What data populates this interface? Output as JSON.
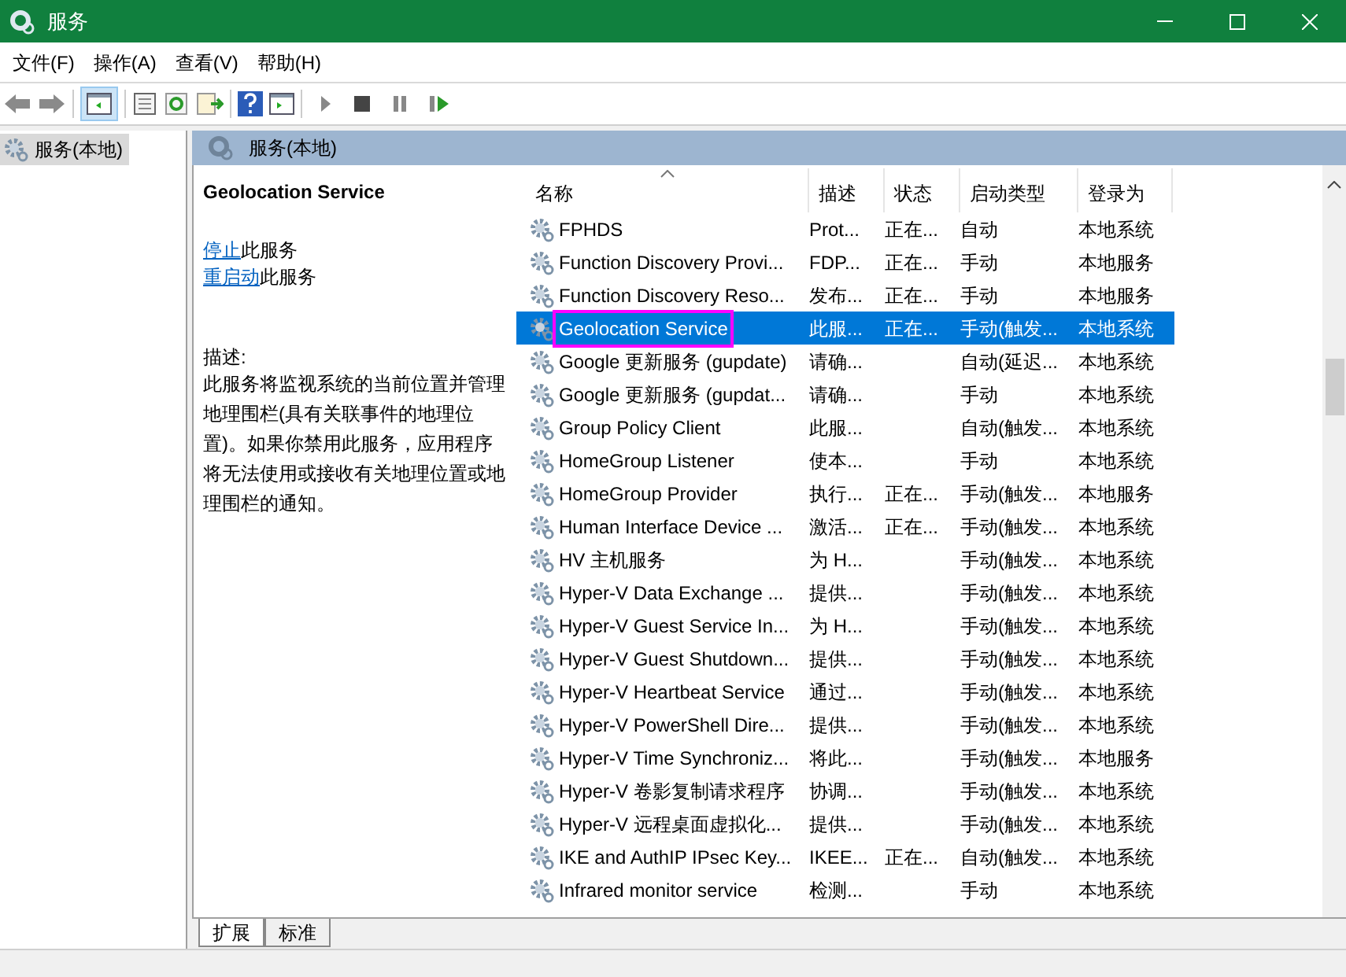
{
  "window": {
    "title": "服务"
  },
  "menu": [
    "文件(F)",
    "操作(A)",
    "查看(V)",
    "帮助(H)"
  ],
  "tree": {
    "items": [
      {
        "label": "服务(本地)",
        "selected": true
      }
    ]
  },
  "panel_header": "服务(本地)",
  "details": {
    "title": "Geolocation Service",
    "actions": [
      {
        "link": "停止",
        "rest": "此服务"
      },
      {
        "link": "重启动",
        "rest": "此服务"
      }
    ],
    "description_label": "描述:",
    "description": "此服务将监视系统的当前位置并管理地理围栏(具有关联事件的地理位置)。如果你禁用此服务，应用程序将无法使用或接收有关地理位置或地理围栏的通知。"
  },
  "table": {
    "columns": [
      {
        "label": "名称",
        "sorted": true
      },
      {
        "label": "描述",
        "sorted": false
      },
      {
        "label": "状态",
        "sorted": false
      },
      {
        "label": "启动类型",
        "sorted": false
      },
      {
        "label": "登录为",
        "sorted": false
      }
    ],
    "rows": [
      {
        "cells": [
          "FPHDS",
          "Prot...",
          "正在...",
          "自动",
          "本地系统"
        ],
        "selected": false,
        "annotated": false
      },
      {
        "cells": [
          "Function Discovery Provi...",
          "FDP...",
          "正在...",
          "手动",
          "本地服务"
        ],
        "selected": false,
        "annotated": false
      },
      {
        "cells": [
          "Function Discovery Reso...",
          "发布...",
          "正在...",
          "手动",
          "本地服务"
        ],
        "selected": false,
        "annotated": false
      },
      {
        "cells": [
          "Geolocation Service",
          "此服...",
          "正在...",
          "手动(触发...",
          "本地系统"
        ],
        "selected": true,
        "annotated": true
      },
      {
        "cells": [
          "Google 更新服务 (gupdate)",
          "请确...",
          "",
          "自动(延迟...",
          "本地系统"
        ],
        "selected": false,
        "annotated": false
      },
      {
        "cells": [
          "Google 更新服务 (gupdat...",
          "请确...",
          "",
          "手动",
          "本地系统"
        ],
        "selected": false,
        "annotated": false
      },
      {
        "cells": [
          "Group Policy Client",
          "此服...",
          "",
          "自动(触发...",
          "本地系统"
        ],
        "selected": false,
        "annotated": false
      },
      {
        "cells": [
          "HomeGroup Listener",
          "使本...",
          "",
          "手动",
          "本地系统"
        ],
        "selected": false,
        "annotated": false
      },
      {
        "cells": [
          "HomeGroup Provider",
          "执行...",
          "正在...",
          "手动(触发...",
          "本地服务"
        ],
        "selected": false,
        "annotated": false
      },
      {
        "cells": [
          "Human Interface Device ...",
          "激活...",
          "正在...",
          "手动(触发...",
          "本地系统"
        ],
        "selected": false,
        "annotated": false
      },
      {
        "cells": [
          "HV 主机服务",
          "为 H...",
          "",
          "手动(触发...",
          "本地系统"
        ],
        "selected": false,
        "annotated": false
      },
      {
        "cells": [
          "Hyper-V Data Exchange ...",
          "提供...",
          "",
          "手动(触发...",
          "本地系统"
        ],
        "selected": false,
        "annotated": false
      },
      {
        "cells": [
          "Hyper-V Guest Service In...",
          "为 H...",
          "",
          "手动(触发...",
          "本地系统"
        ],
        "selected": false,
        "annotated": false
      },
      {
        "cells": [
          "Hyper-V Guest Shutdown...",
          "提供...",
          "",
          "手动(触发...",
          "本地系统"
        ],
        "selected": false,
        "annotated": false
      },
      {
        "cells": [
          "Hyper-V Heartbeat Service",
          "通过...",
          "",
          "手动(触发...",
          "本地系统"
        ],
        "selected": false,
        "annotated": false
      },
      {
        "cells": [
          "Hyper-V PowerShell Dire...",
          "提供...",
          "",
          "手动(触发...",
          "本地系统"
        ],
        "selected": false,
        "annotated": false
      },
      {
        "cells": [
          "Hyper-V Time Synchroniz...",
          "将此...",
          "",
          "手动(触发...",
          "本地服务"
        ],
        "selected": false,
        "annotated": false
      },
      {
        "cells": [
          "Hyper-V 卷影复制请求程序",
          "协调...",
          "",
          "手动(触发...",
          "本地系统"
        ],
        "selected": false,
        "annotated": false
      },
      {
        "cells": [
          "Hyper-V 远程桌面虚拟化...",
          "提供...",
          "",
          "手动(触发...",
          "本地系统"
        ],
        "selected": false,
        "annotated": false
      },
      {
        "cells": [
          "IKE and AuthIP IPsec Key...",
          "IKEE...",
          "正在...",
          "自动(触发...",
          "本地系统"
        ],
        "selected": false,
        "annotated": false
      },
      {
        "cells": [
          "Infrared monitor service",
          "检测...",
          "",
          "手动",
          "本地系统"
        ],
        "selected": false,
        "annotated": false
      }
    ]
  },
  "bottom_tabs": [
    {
      "label": "扩展",
      "selected": true
    },
    {
      "label": "标准",
      "selected": false
    }
  ]
}
